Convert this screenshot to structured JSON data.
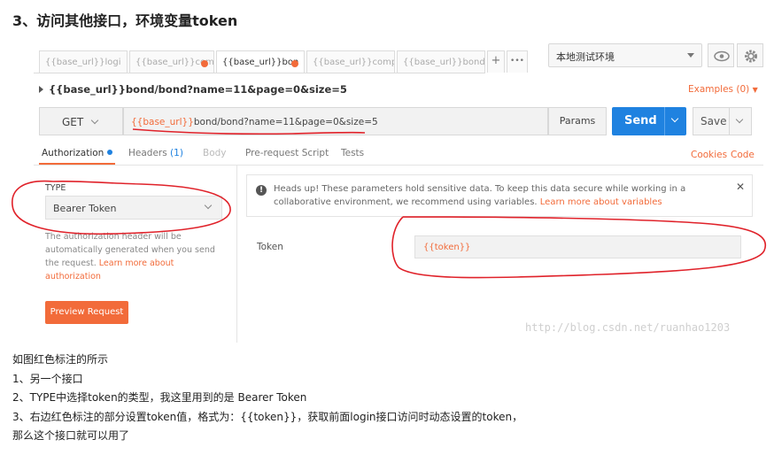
{
  "heading": "3、访问其他接口，环境变量token",
  "tabs": [
    {
      "label": "{{base_url}}logi",
      "active": false,
      "dot": false
    },
    {
      "label": "{{base_url}}com",
      "active": false,
      "dot": true
    },
    {
      "label": "{{base_url}}bon",
      "active": true,
      "dot": true
    },
    {
      "label": "{{base_url}}company",
      "active": false,
      "dot": false
    },
    {
      "label": "{{base_url}}bond/bas",
      "active": false,
      "dot": false
    }
  ],
  "tab_controls": {
    "add": "+",
    "more": "•••"
  },
  "environment": {
    "selected": "本地测试环境",
    "icons": [
      "eye-icon",
      "gear-icon"
    ]
  },
  "request": {
    "title": "{{base_url}}bond/bond?name=11&page=0&size=5",
    "examples": "Examples (0)",
    "method": "GET",
    "url_var": "{{base_url}}",
    "url_rest": "bond/bond?name=11&page=0&size=5",
    "params": "Params",
    "send": "Send",
    "save": "Save"
  },
  "subtabs": [
    {
      "label": "Authorization",
      "kind": "active"
    },
    {
      "label": "Headers",
      "count": "(1)",
      "kind": "normal"
    },
    {
      "label": "Body",
      "kind": "dim"
    },
    {
      "label": "Pre-request Script",
      "kind": "normal"
    },
    {
      "label": "Tests",
      "kind": "normal"
    }
  ],
  "right_links": {
    "cookies": "Cookies",
    "code": "Code"
  },
  "auth": {
    "type_label": "TYPE",
    "type_value": "Bearer Token",
    "note": "The authorization header will be automatically generated when you send the request.",
    "note_link": "Learn more about authorization",
    "preview": "Preview Request"
  },
  "notice": {
    "text": "Heads up! These parameters hold sensitive data. To keep this data secure while working in a collaborative environment, we recommend using variables.",
    "link": "Learn more about variables"
  },
  "token": {
    "label": "Token",
    "value": "{{token}}"
  },
  "watermark": "http://blog.csdn.net/ruanhao1203",
  "caption": [
    "如图红色标注的所示",
    "1、另一个接口",
    "2、TYPE中选择token的类型，我这里用到的是 Bearer Token",
    "3、右边红色标注的部分设置token值，格式为：{{token}}，获取前面login接口访问时动态设置的token，",
    "那么这个接口就可以用了"
  ],
  "colors": {
    "accent": "#f26b3a",
    "send": "#1f82e0",
    "annotation": "#e0222a"
  }
}
